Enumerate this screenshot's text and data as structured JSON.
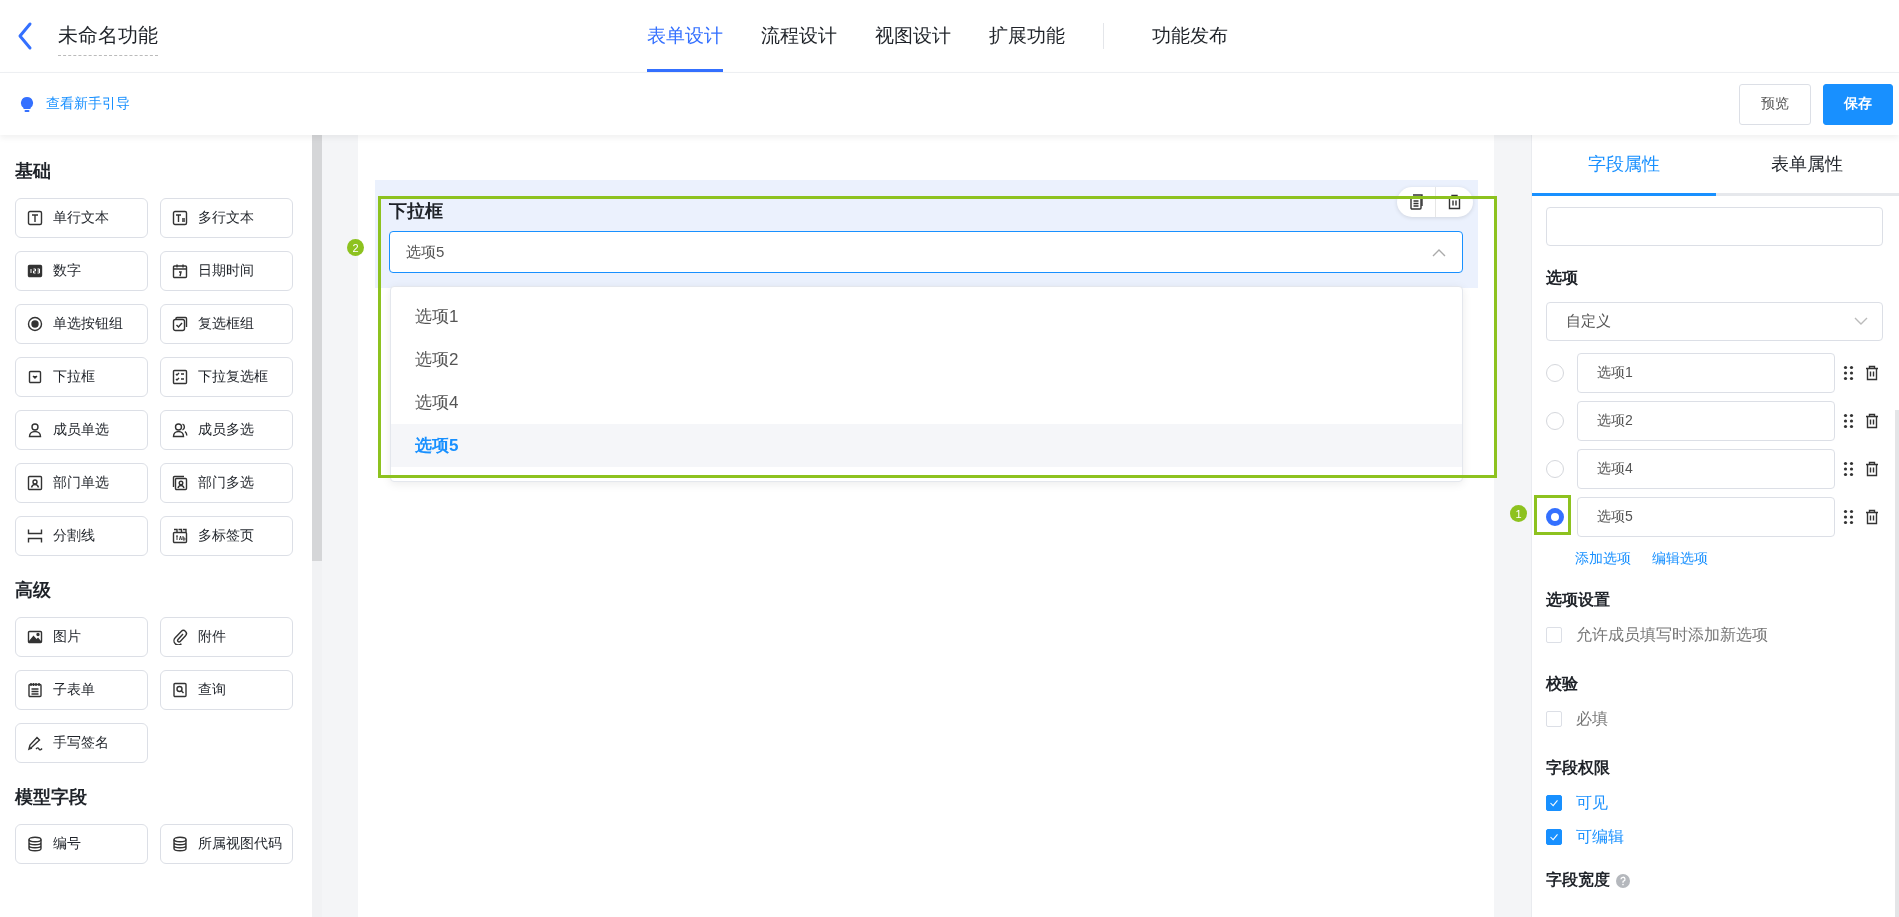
{
  "header": {
    "title": "未命名功能",
    "tabs": [
      {
        "label": "表单设计",
        "selected": true
      },
      {
        "label": "流程设计",
        "selected": false
      },
      {
        "label": "视图设计",
        "selected": false
      },
      {
        "label": "扩展功能",
        "selected": false
      }
    ],
    "publish": "功能发布"
  },
  "toolbar": {
    "guide_link": "查看新手引导",
    "buttons": [
      {
        "label": "预览",
        "kind": "default"
      },
      {
        "label": "保存",
        "kind": "primary"
      }
    ]
  },
  "palette": {
    "sections": [
      {
        "title": "基础",
        "items": [
          "单行文本",
          "多行文本",
          "数字",
          "日期时间",
          "单选按钮组",
          "复选框组",
          "下拉框",
          "下拉复选框",
          "成员单选",
          "成员多选",
          "部门单选",
          "部门多选",
          "分割线",
          "多标签页"
        ]
      },
      {
        "title": "高级",
        "items": [
          "图片",
          "附件",
          "子表单",
          "查询",
          "手写签名"
        ]
      },
      {
        "title": "模型字段",
        "items": [
          "编号",
          "所属视图代码"
        ]
      }
    ]
  },
  "canvas": {
    "field": {
      "label": "下拉框",
      "value": "选项5",
      "expanded": true,
      "options": [
        {
          "label": "选项1",
          "selected": false
        },
        {
          "label": "选项2",
          "selected": false
        },
        {
          "label": "选项4",
          "selected": false
        },
        {
          "label": "选项5",
          "selected": true
        }
      ]
    }
  },
  "annotations": [
    {
      "number": "1"
    },
    {
      "number": "2"
    }
  ],
  "properties": {
    "tabs": [
      {
        "label": "字段属性",
        "selected": true
      },
      {
        "label": "表单属性",
        "selected": false
      }
    ],
    "options_title": "选项",
    "source": "自定义",
    "options": [
      {
        "label": "选项1",
        "selected": false
      },
      {
        "label": "选项2",
        "selected": false
      },
      {
        "label": "选项4",
        "selected": false
      },
      {
        "label": "选项5",
        "selected": true
      }
    ],
    "links": [
      "添加选项",
      "编辑选项"
    ],
    "groups": [
      {
        "title": "选项设置",
        "checkboxes": [
          {
            "label": "允许成员填写时添加新选项",
            "checked": false
          }
        ]
      },
      {
        "title": "校验",
        "checkboxes": [
          {
            "label": "必填",
            "checked": false
          }
        ]
      },
      {
        "title": "字段权限",
        "checkboxes": [
          {
            "label": "可见",
            "checked": true
          },
          {
            "label": "可编辑",
            "checked": true
          }
        ]
      }
    ],
    "width_title": "字段宽度"
  }
}
